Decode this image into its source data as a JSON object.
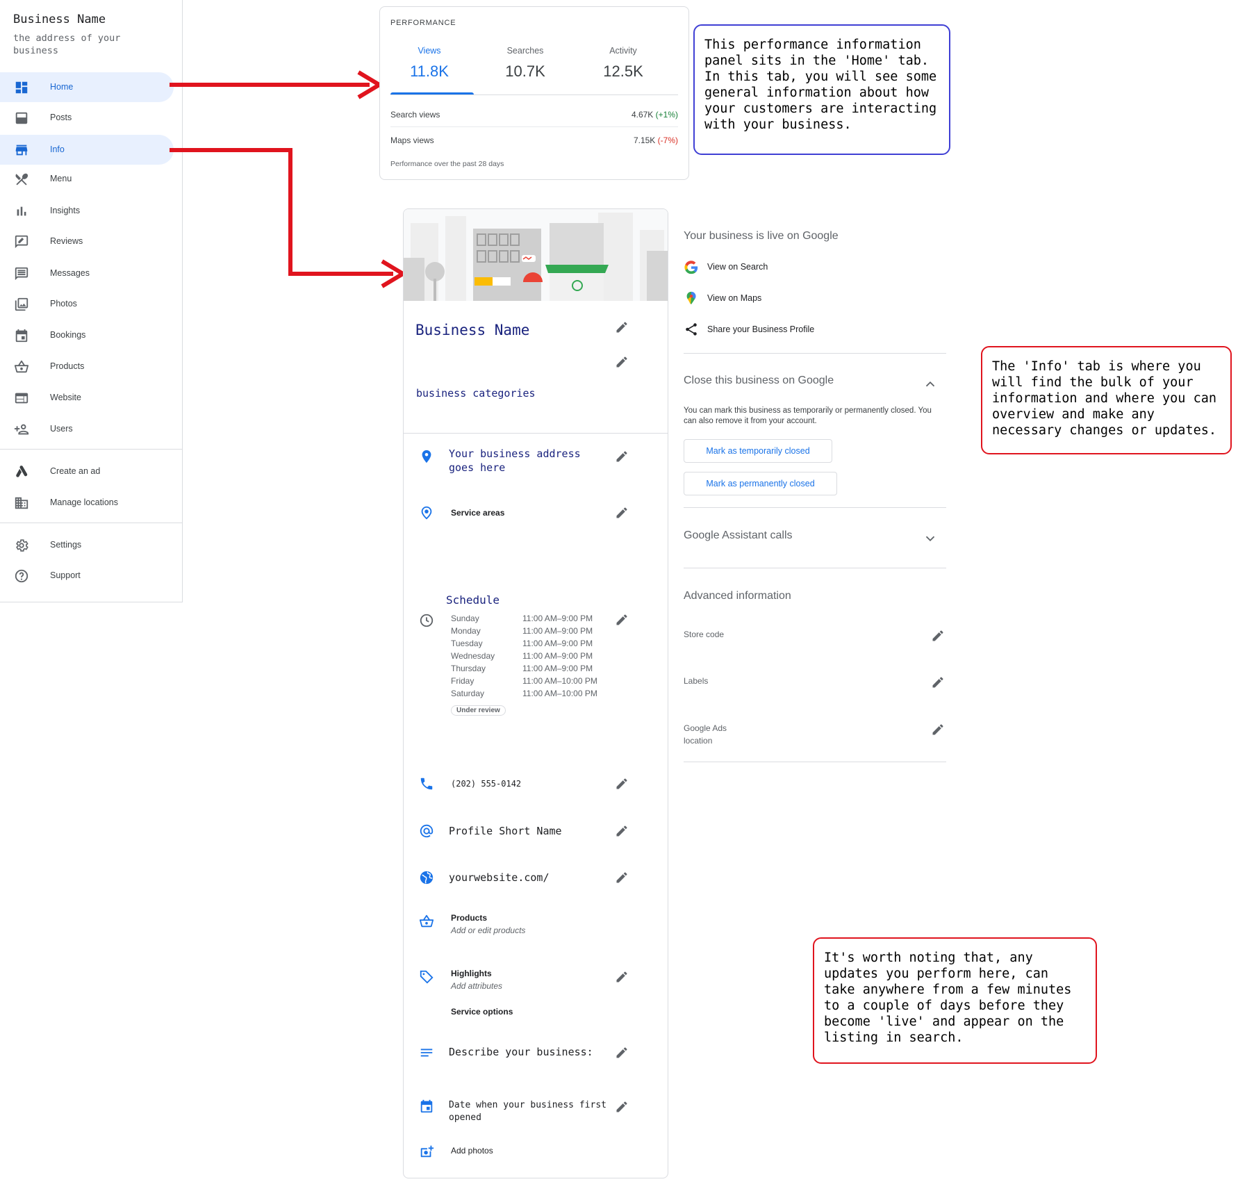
{
  "sidebar": {
    "business_name": "Business Name",
    "business_address": "the address of your business",
    "items": [
      {
        "label": "Home",
        "icon": "dashboard-icon",
        "active": true
      },
      {
        "label": "Posts",
        "icon": "posts-icon"
      },
      {
        "label": "Info",
        "icon": "storefront-icon",
        "active": true
      },
      {
        "label": "Menu",
        "icon": "utensils-icon"
      },
      {
        "label": "Insights",
        "icon": "bar-chart-icon"
      },
      {
        "label": "Reviews",
        "icon": "reviews-icon"
      },
      {
        "label": "Messages",
        "icon": "message-icon"
      },
      {
        "label": "Photos",
        "icon": "photos-icon"
      },
      {
        "label": "Bookings",
        "icon": "calendar-icon"
      },
      {
        "label": "Products",
        "icon": "basket-icon"
      },
      {
        "label": "Website",
        "icon": "website-icon"
      },
      {
        "label": "Users",
        "icon": "add-user-icon"
      },
      {
        "label": "Create an ad",
        "icon": "google-ads-icon"
      },
      {
        "label": "Manage locations",
        "icon": "building-icon"
      },
      {
        "label": "Settings",
        "icon": "gear-icon"
      },
      {
        "label": "Support",
        "icon": "help-icon"
      }
    ]
  },
  "performance": {
    "title": "PERFORMANCE",
    "tabs": [
      {
        "label": "Views",
        "value": "11.8K",
        "selected": true
      },
      {
        "label": "Searches",
        "value": "10.7K"
      },
      {
        "label": "Activity",
        "value": "12.5K"
      }
    ],
    "rows": [
      {
        "label": "Search views",
        "value": "4.67K",
        "change": "(+1%)"
      },
      {
        "label": "Maps views",
        "value": "7.15K",
        "change": "(-7%)"
      }
    ],
    "note": "Performance over the past 28 days"
  },
  "info_card": {
    "business_name": "Business Name",
    "categories": "business categories",
    "address": "Your business address goes here",
    "service_areas_label": "Service areas",
    "schedule_title": "Schedule",
    "schedule": [
      {
        "day": "Sunday",
        "hours": "11:00 AM–9:00 PM"
      },
      {
        "day": "Monday",
        "hours": "11:00 AM–9:00 PM"
      },
      {
        "day": "Tuesday",
        "hours": "11:00 AM–9:00 PM"
      },
      {
        "day": "Wednesday",
        "hours": "11:00 AM–9:00 PM"
      },
      {
        "day": "Thursday",
        "hours": "11:00 AM–9:00 PM"
      },
      {
        "day": "Friday",
        "hours": "11:00 AM–10:00 PM"
      },
      {
        "day": "Saturday",
        "hours": "11:00 AM–10:00 PM"
      }
    ],
    "under_review": "Under review",
    "phone": "(202) 555-0142",
    "short_name": "Profile Short Name",
    "website": "yourwebsite.com/",
    "products_label": "Products",
    "products_sub": "Add or edit products",
    "highlights_label": "Highlights",
    "highlights_sub": "Add attributes",
    "service_options_label": "Service options",
    "description": "Describe your business:",
    "opening_date": "Date when your business first opened",
    "add_photos": "Add photos"
  },
  "right_panel": {
    "live_heading": "Your business is live on Google",
    "view_search": "View on Search",
    "view_maps": "View on Maps",
    "share_profile": "Share your Business Profile",
    "close_heading": "Close this business on Google",
    "close_desc": "You can mark this business as temporarily or permanently closed. You can also remove it from your account.",
    "mark_temp": "Mark as temporarily closed",
    "mark_perm": "Mark as permanently closed",
    "assistant_heading": "Google Assistant calls",
    "advanced_heading": "Advanced information",
    "store_code": "Store code",
    "labels": "Labels",
    "ads_location": "Google Ads location"
  },
  "callouts": {
    "performance": "This performance information panel sits in the 'Home' tab. In this tab, you will see some general information about how your customers are interacting with your business.",
    "info": "The 'Info' tab is where you will find the bulk of your information and where you can overview and make any necessary changes or updates.",
    "updates": "It's worth noting that, any updates you perform here, can take anywhere from a few minutes to a couple of days before they become 'live' and appear on the listing in search."
  },
  "colors": {
    "accent": "#1a73e8",
    "active_bg": "#e8f0fe",
    "arrow_red": "#e0141e",
    "callout_blue": "#3f3fd4",
    "positive": "#188038",
    "negative": "#d93025"
  }
}
